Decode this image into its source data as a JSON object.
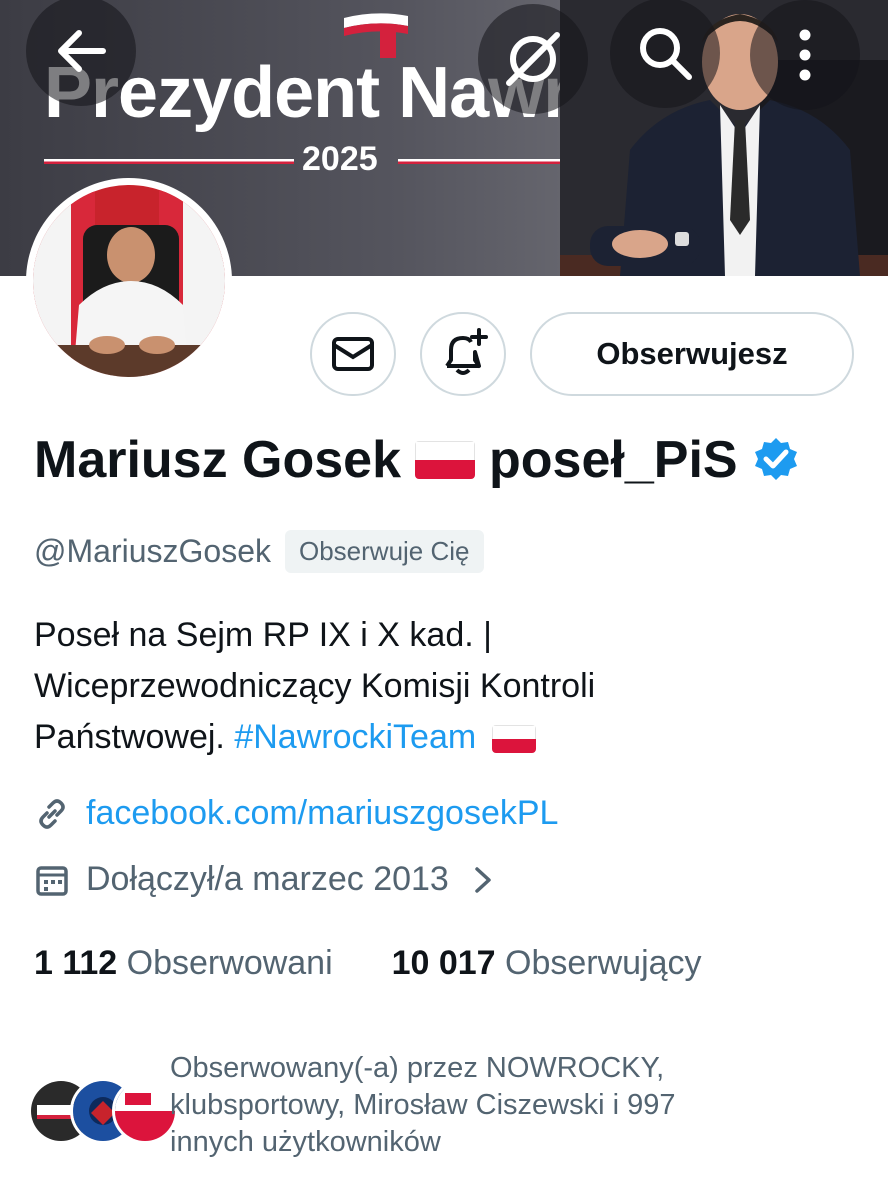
{
  "banner": {
    "title": "Prezydent Nawrocki",
    "year": "2025"
  },
  "topbar": {
    "back_icon": "arrow-left-icon",
    "grok_icon": "grok-icon",
    "search_icon": "search-icon",
    "more_icon": "more-vertical-icon"
  },
  "actions": {
    "message_icon": "envelope-icon",
    "notify_icon": "bell-plus-icon",
    "follow_label": "Obserwujesz"
  },
  "profile": {
    "name": "Mariusz Gosek",
    "name_suffix": "poseł_PiS",
    "handle": "@MariuszGosek",
    "follows_you": "Obserwuje Cię",
    "bio_line1": "Poseł na Sejm RP IX i X kad. |",
    "bio_line2": "Wiceprzewodniczący Komisji Kontroli",
    "bio_line3_text": "Państwowej.",
    "bio_hashtag": "#NawrockiTeam",
    "link": "facebook.com/mariuszgosekPL",
    "joined": "Dołączył/a marzec 2013"
  },
  "stats": {
    "following_count": "1 112",
    "following_label": "Obserwowani",
    "followers_count": "10 017",
    "followers_label": "Obserwujący"
  },
  "followed_by": {
    "line1": "Obserwowany(-a) przez NOWROCKY,",
    "line2": "klubsportowy, Mirosław Ciszewski i 997",
    "line3": "innych użytkowników"
  },
  "colors": {
    "accent": "#1d9bf0",
    "flag_red": "#dc143c",
    "muted": "#536471"
  }
}
